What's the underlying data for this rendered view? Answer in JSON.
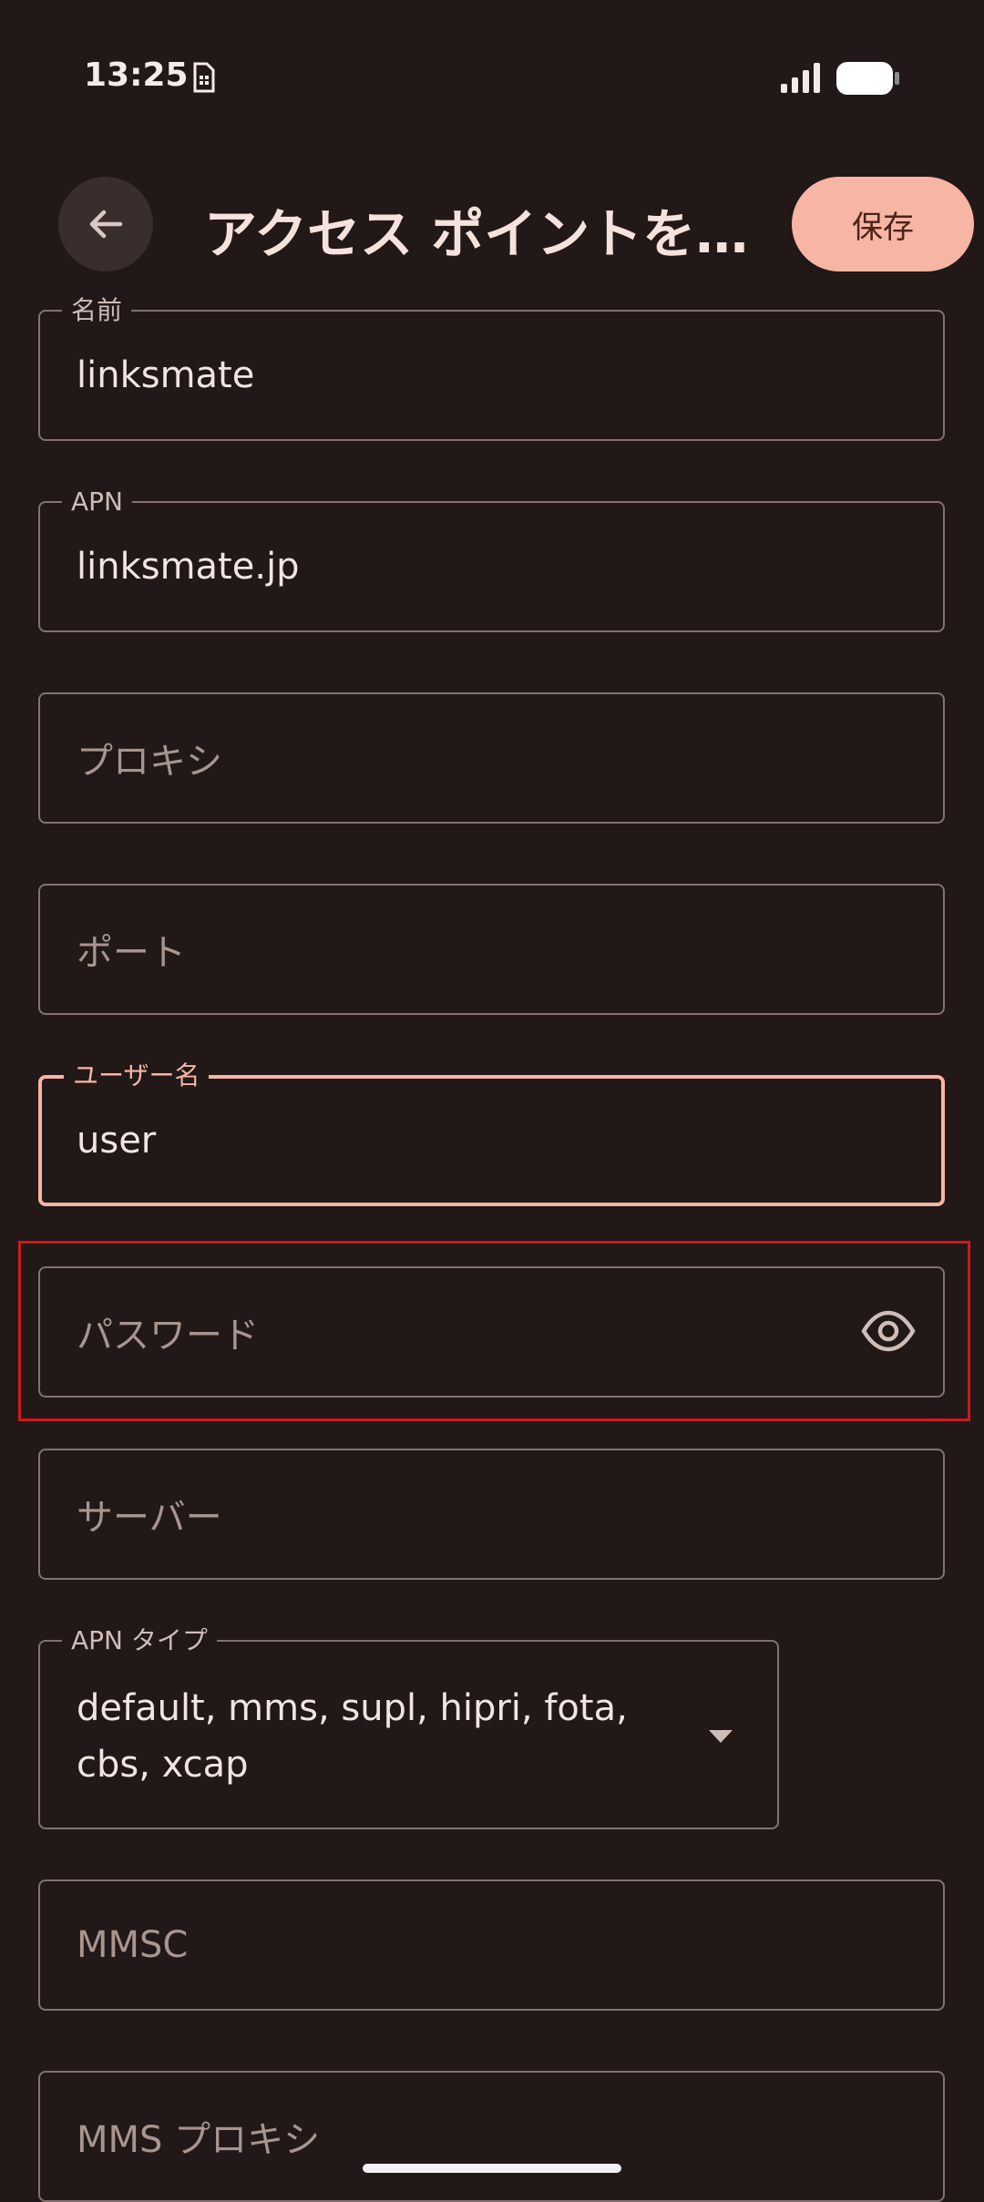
{
  "status_bar": {
    "time": "13:25"
  },
  "app_bar": {
    "title": "アクセス ポイントを…",
    "save_label": "保存"
  },
  "fields": {
    "name": {
      "label": "名前",
      "value": "linksmate"
    },
    "apn": {
      "label": "APN",
      "value": "linksmate.jp"
    },
    "proxy": {
      "placeholder": "プロキシ"
    },
    "port": {
      "placeholder": "ポート"
    },
    "username": {
      "label": "ユーザー名",
      "value": "user"
    },
    "password": {
      "placeholder": "パスワード"
    },
    "server": {
      "placeholder": "サーバー"
    },
    "apn_type": {
      "label": "APN タイプ",
      "value": "default, mms, supl, hipri, fota, cbs, xcap"
    },
    "mmsc": {
      "placeholder": "MMSC"
    },
    "mms_proxy": {
      "placeholder": "MMS プロキシ"
    }
  },
  "icons": {
    "back": "arrow-back-icon",
    "sim": "sim-card-icon",
    "signal": "cell-signal-icon",
    "battery": "battery-icon",
    "eye": "visibility-icon",
    "dropdown": "dropdown-arrow-icon"
  },
  "colors": {
    "background": "#211817",
    "accent": "#f7b5a3",
    "outline": "#85716d",
    "highlight": "#d0191c"
  }
}
